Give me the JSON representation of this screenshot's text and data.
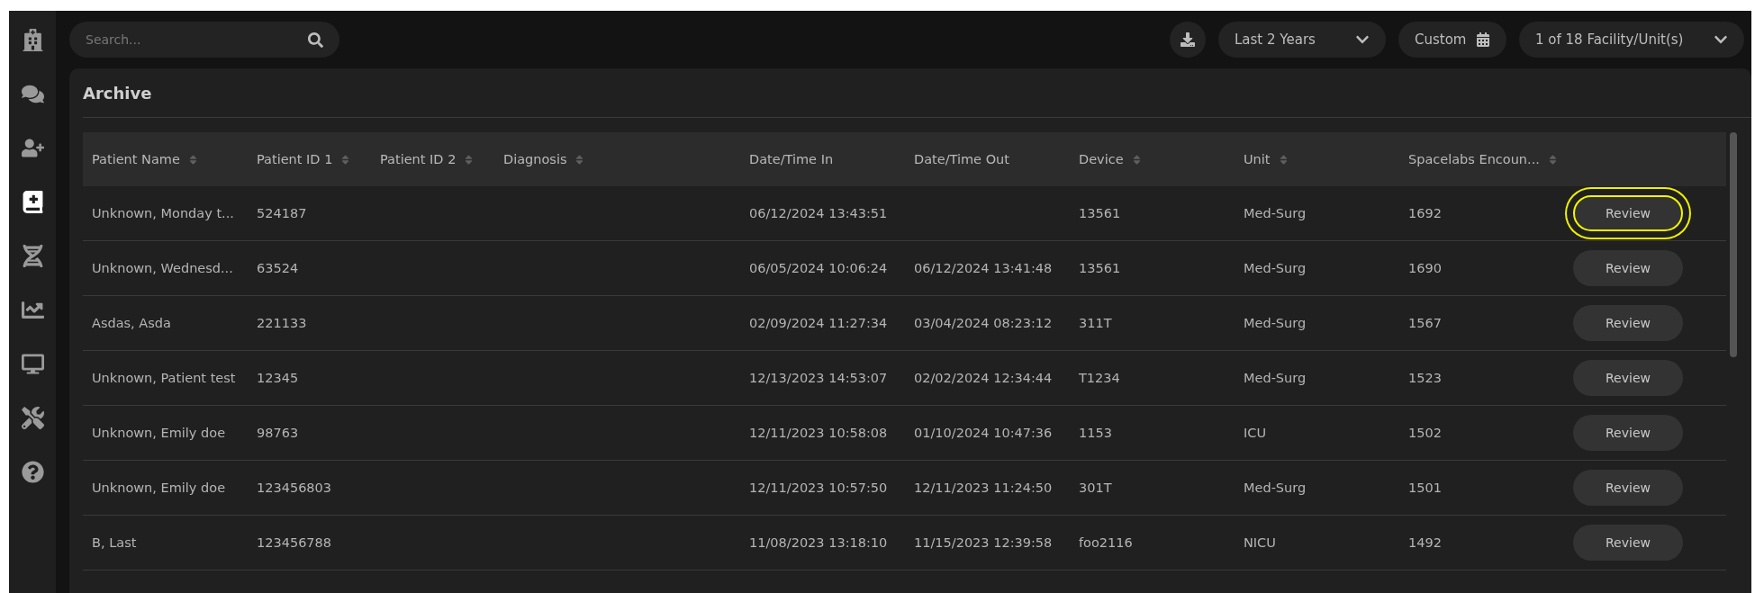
{
  "sidebar": {
    "items": [
      {
        "selected": false
      },
      {
        "selected": false
      },
      {
        "selected": false
      },
      {
        "selected": true
      },
      {
        "selected": false
      },
      {
        "selected": false
      },
      {
        "selected": false
      },
      {
        "selected": false
      },
      {
        "selected": false
      }
    ]
  },
  "toolbar": {
    "search": {
      "placeholder": "Search..."
    },
    "range": "Last 2 Years",
    "custom": "Custom",
    "facility": "1 of 18 Facility/Unit(s)"
  },
  "archive": {
    "title": "Archive",
    "table": {
      "columns": [
        {
          "label": "Patient Name",
          "sortable": true
        },
        {
          "label": "Patient ID 1",
          "sortable": true
        },
        {
          "label": "Patient ID 2",
          "sortable": true
        },
        {
          "label": "Diagnosis",
          "sortable": true
        },
        {
          "label": "Date/Time In",
          "sortable": false
        },
        {
          "label": "Date/Time Out",
          "sortable": false
        },
        {
          "label": "Device",
          "sortable": true
        },
        {
          "label": "Unit",
          "sortable": true
        },
        {
          "label": "Spacelabs Encoun...",
          "sortable": true
        }
      ],
      "rows": [
        {
          "cells": [
            "Unknown, Monday t...",
            "524187",
            "",
            "",
            "06/12/2024 13:43:51",
            "",
            "13561",
            "Med-Surg",
            "1692"
          ],
          "action": "Review",
          "highlighted": true
        },
        {
          "cells": [
            "Unknown, Wednesd...",
            "63524",
            "",
            "",
            "06/05/2024 10:06:24",
            "06/12/2024 13:41:48",
            "13561",
            "Med-Surg",
            "1690"
          ],
          "action": "Review",
          "highlighted": false
        },
        {
          "cells": [
            "Asdas, Asda",
            "221133",
            "",
            "",
            "02/09/2024 11:27:34",
            "03/04/2024 08:23:12",
            "311T",
            "Med-Surg",
            "1567"
          ],
          "action": "Review",
          "highlighted": false
        },
        {
          "cells": [
            "Unknown, Patient test",
            "12345",
            "",
            "",
            "12/13/2023 14:53:07",
            "02/02/2024 12:34:44",
            "T1234",
            "Med-Surg",
            "1523"
          ],
          "action": "Review",
          "highlighted": false
        },
        {
          "cells": [
            "Unknown, Emily doe",
            "98763",
            "",
            "",
            "12/11/2023 10:58:08",
            "01/10/2024 10:47:36",
            "1153",
            "ICU",
            "1502"
          ],
          "action": "Review",
          "highlighted": false
        },
        {
          "cells": [
            "Unknown, Emily doe",
            "123456803",
            "",
            "",
            "12/11/2023 10:57:50",
            "12/11/2023 11:24:50",
            "301T",
            "Med-Surg",
            "1501"
          ],
          "action": "Review",
          "highlighted": false
        },
        {
          "cells": [
            "B, Last",
            "123456788",
            "",
            "",
            "11/08/2023 13:18:10",
            "11/15/2023 12:39:58",
            "foo2116",
            "NICU",
            "1492"
          ],
          "action": "Review",
          "highlighted": false
        }
      ]
    }
  }
}
